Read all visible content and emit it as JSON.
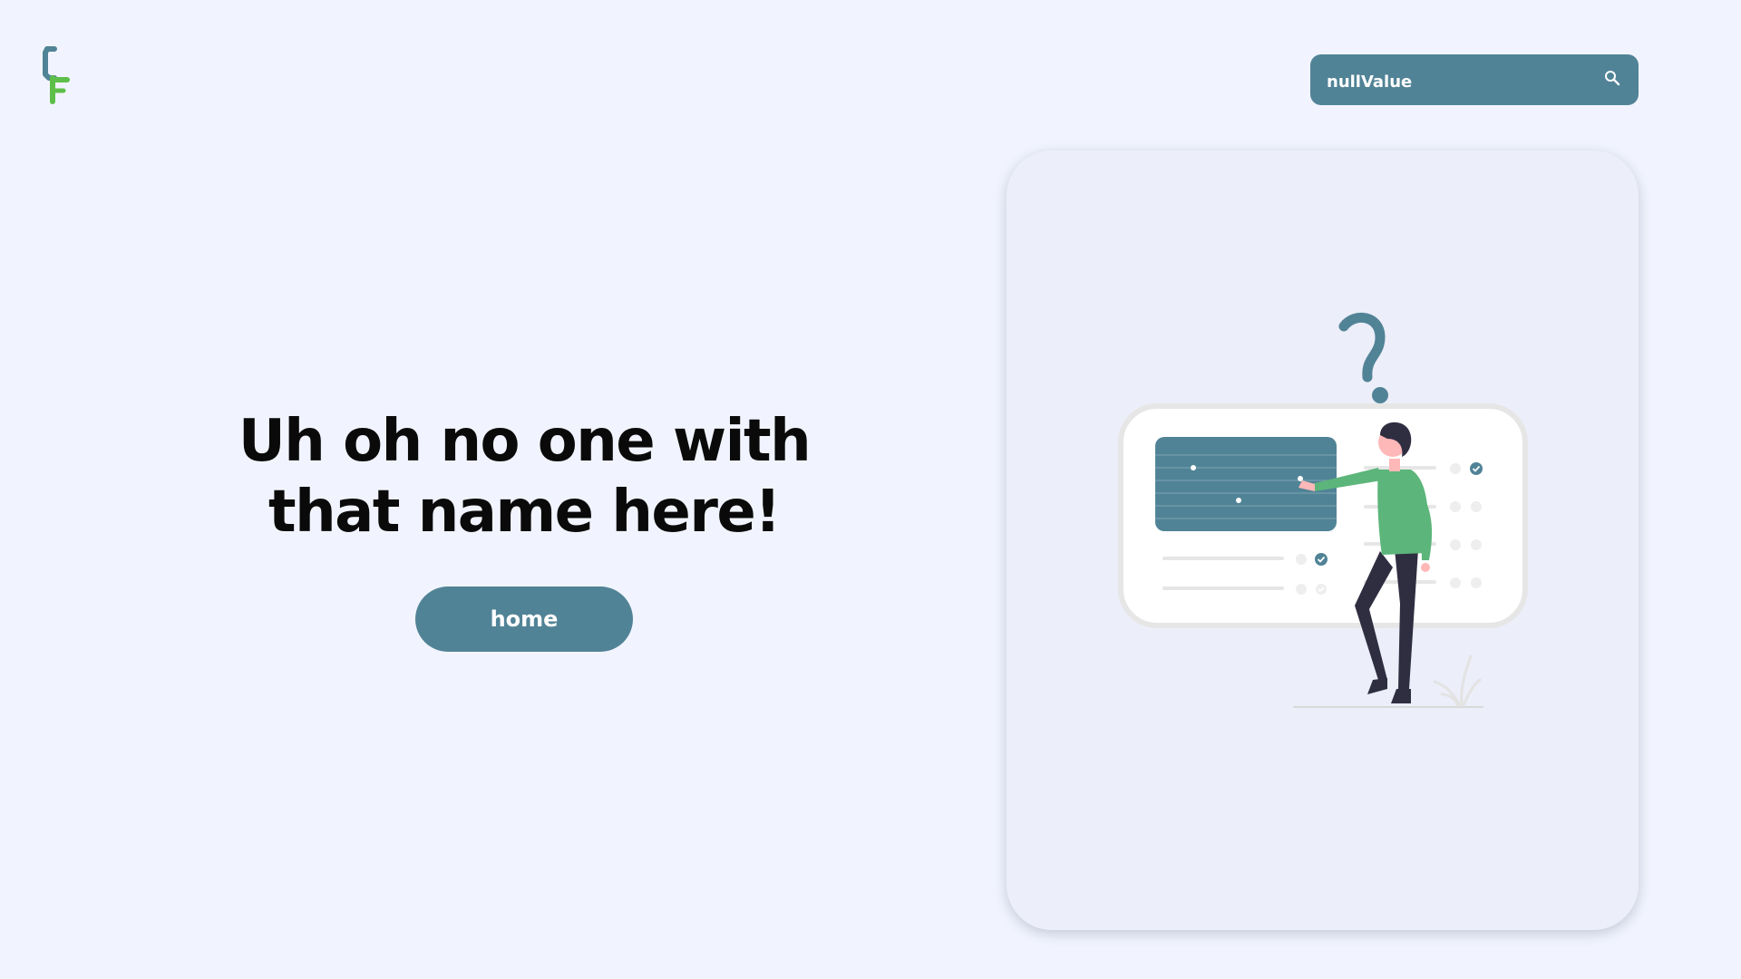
{
  "header": {
    "logo_icon": "cf-logo-icon"
  },
  "search": {
    "value": "nullValue",
    "icon": "search-icon"
  },
  "message": {
    "line1": "Uh oh no one with",
    "line2": "that name here!"
  },
  "actions": {
    "home_label": "home"
  },
  "illustration": {
    "name": "person-pointing-at-board-with-question-mark",
    "question_mark": "?"
  },
  "colors": {
    "background": "#f1f4fe",
    "accent": "#518396",
    "green": "#5cb57a",
    "logo_green": "#5dbf4a",
    "card": "#eceef9",
    "text": "#0a0a0a"
  }
}
